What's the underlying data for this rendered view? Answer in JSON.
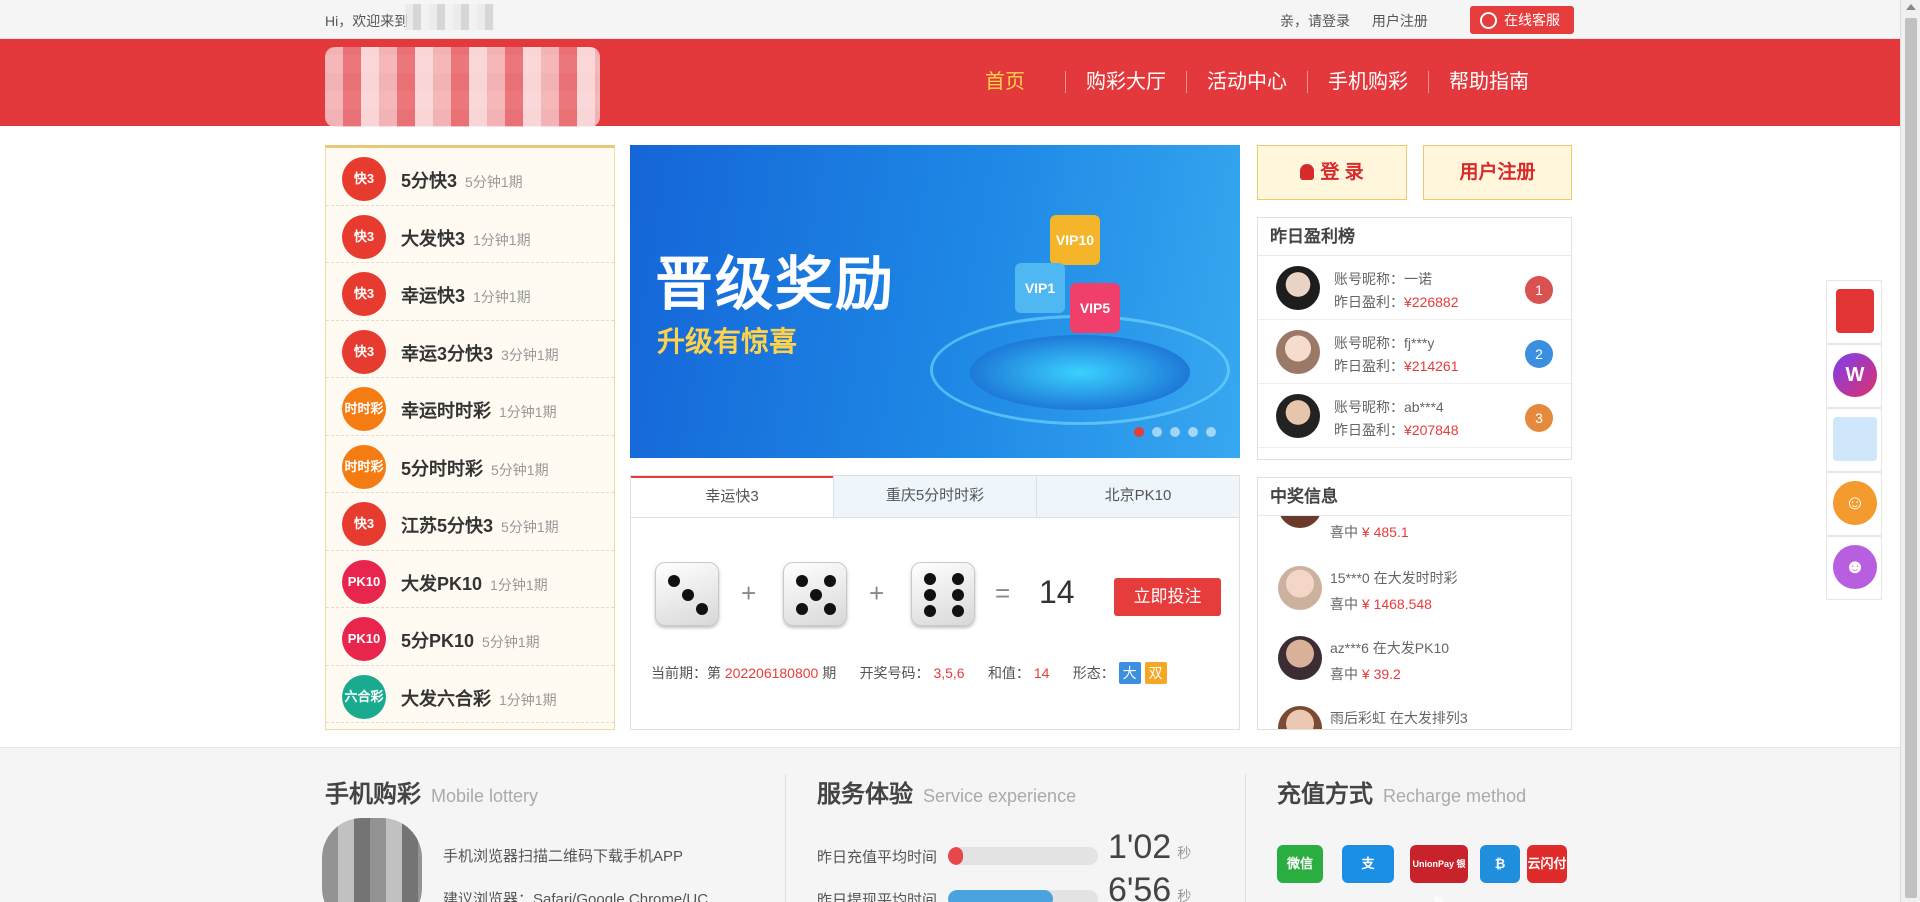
{
  "topbar": {
    "greeting": "Hi，欢迎来到",
    "login_prompt": "亲，请登录",
    "register_link": "用户注册",
    "service_label": "在线客服"
  },
  "header": {
    "nav": [
      "首页",
      "购彩大厅",
      "活动中心",
      "手机购彩",
      "帮助指南"
    ]
  },
  "games": [
    {
      "name": "5分快3",
      "period": "5分钟1期",
      "icon": "快3",
      "color": "#e63b2e"
    },
    {
      "name": "大发快3",
      "period": "1分钟1期",
      "icon": "快3",
      "color": "#e63b2e"
    },
    {
      "name": "幸运快3",
      "period": "1分钟1期",
      "icon": "快3",
      "color": "#e63b2e"
    },
    {
      "name": "幸运3分快3",
      "period": "3分钟1期",
      "icon": "快3",
      "color": "#e63b2e"
    },
    {
      "name": "幸运时时彩",
      "period": "1分钟1期",
      "icon": "时时彩",
      "color": "#f57c12"
    },
    {
      "name": "5分时时彩",
      "period": "5分钟1期",
      "icon": "时时彩",
      "color": "#f57c12"
    },
    {
      "name": "江苏5分快3",
      "period": "5分钟1期",
      "icon": "快3",
      "color": "#e63b2e"
    },
    {
      "name": "大发PK10",
      "period": "1分钟1期",
      "icon": "PK10",
      "color": "#e8254d"
    },
    {
      "name": "5分PK10",
      "period": "5分钟1期",
      "icon": "PK10",
      "color": "#e8254d"
    },
    {
      "name": "大发六合彩",
      "period": "1分钟1期",
      "icon": "六合彩",
      "color": "#1aab8f"
    }
  ],
  "banner": {
    "title": "晋级奖励",
    "subtitle": "升级有惊喜",
    "cubes": [
      "VIP10",
      "VIP1",
      "VIP5"
    ]
  },
  "draw": {
    "tabs": [
      "幸运快3",
      "重庆5分时时彩",
      "北京PK10"
    ],
    "dice": [
      3,
      5,
      6
    ],
    "plus": "+",
    "equals": "=",
    "sum": "14",
    "bet_label": "立即投注",
    "period_label": "当前期：第",
    "period": "202206180800",
    "period_suffix": "期",
    "numbers_label": "开奖号码：",
    "numbers": "3,5,6",
    "sum_label": "和值：",
    "sum_value": "14",
    "form_label": "形态：",
    "form_big": "大",
    "form_even": "双"
  },
  "account": {
    "login_label": "登 录",
    "register_label": "用户注册"
  },
  "ranking": {
    "title": "昨日盈利榜",
    "nick_label": "账号昵称：",
    "profit_label": "昨日盈利：",
    "rows": [
      {
        "nick": "一诺",
        "profit": "¥226882",
        "rank": "1",
        "rank_color": "#d9524f"
      },
      {
        "nick": "fj***y",
        "profit": "¥214261",
        "rank": "2",
        "rank_color": "#3b8fe0"
      },
      {
        "nick": "ab***4",
        "profit": "¥207848",
        "rank": "3",
        "rank_color": "#e58a3c"
      }
    ]
  },
  "winners": {
    "title": "中奖信息",
    "hit_label": "喜中",
    "rows": [
      {
        "who": "",
        "amount": "¥ 485.1"
      },
      {
        "who": "15***0 在大发时时彩",
        "amount": "¥ 1468.548"
      },
      {
        "who": "az***6 在大发PK10",
        "amount": "¥ 39.2"
      },
      {
        "who": "雨后彩虹 在大发排列3",
        "amount": ""
      }
    ]
  },
  "float_icons": [
    "red-envelope-icon",
    "w-app-icon",
    "blurred-icon",
    "group-chat-icon",
    "customer-service-icon"
  ],
  "footer": {
    "mobile_title": "手机购彩",
    "mobile_sub": "Mobile lottery",
    "mobile_text1": "手机浏览器扫描二维码下载手机APP",
    "mobile_text2": "建议浏览器：Safari/Google Chrome/UC",
    "service_title": "服务体验",
    "service_sub": "Service experience",
    "recharge_label": "昨日充值平均时间",
    "recharge_time": "1'02",
    "recharge_level": 0.1,
    "withdraw_label": "昨日提现平均时间",
    "withdraw_time": "6'56",
    "withdraw_level": 0.7,
    "seconds_unit": "秒",
    "pay_title": "充值方式",
    "pay_sub": "Recharge method",
    "pay_methods": [
      {
        "icon": "wechat-pay-icon",
        "text": "微信",
        "color": "#2aae40"
      },
      {
        "icon": "alipay-icon",
        "text": "支",
        "color": "#1b8ee6"
      },
      {
        "icon": "unionpay-icon",
        "text": "UnionPay 银联",
        "color": "#c8232b"
      },
      {
        "icon": "bitcoin-icon",
        "text": "₿",
        "color": "#1f8fdd"
      },
      {
        "icon": "cloud-quickpass-icon",
        "text": "云闪付",
        "color": "#e02b2b"
      }
    ]
  }
}
